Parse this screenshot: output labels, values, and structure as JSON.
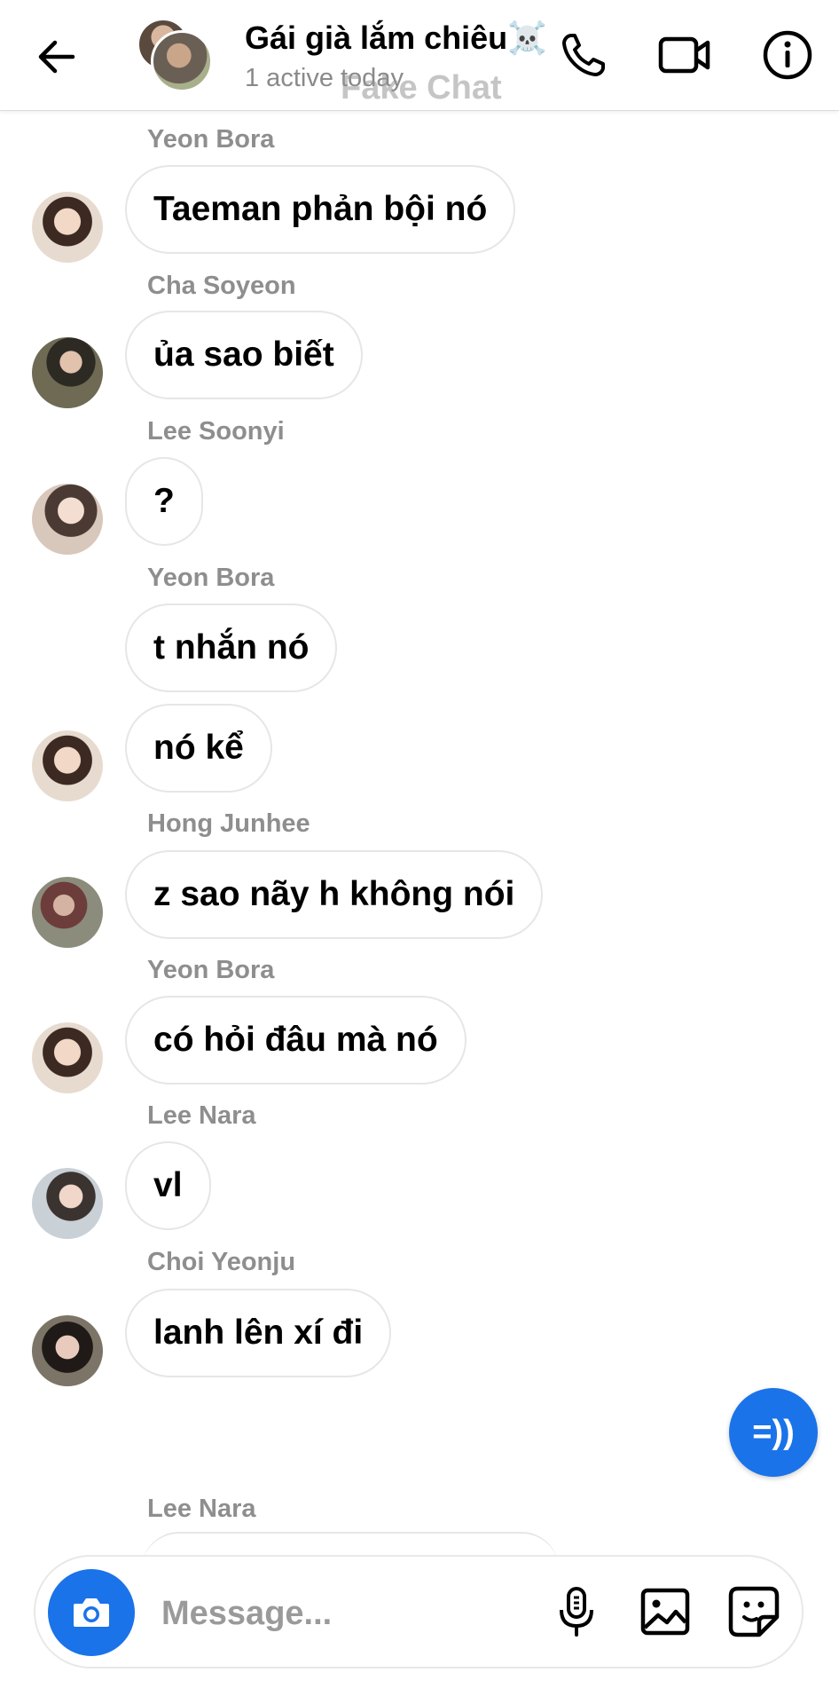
{
  "header": {
    "title": "Gái già lắm chiêu☠️",
    "status": "1 active today",
    "watermark": "Fake Chat"
  },
  "messages": [
    {
      "sender": "Yeon Bora",
      "text": "Taeman phản bội nó"
    },
    {
      "sender": "Cha Soyeon",
      "text": "ủa sao biết"
    },
    {
      "sender": "Lee Soonyi",
      "text": "?"
    },
    {
      "sender": "Yeon Bora",
      "text": "t nhắn nó"
    },
    {
      "sender": "",
      "text": "nó kể"
    },
    {
      "sender": "Hong Junhee",
      "text": "z sao nãy h không nói"
    },
    {
      "sender": "Yeon Bora",
      "text": "có hỏi đâu mà nó"
    },
    {
      "sender": "Lee Nara",
      "text": "vl"
    },
    {
      "sender": "Choi Yeonju",
      "text": "lanh lên xí đi"
    },
    {
      "sender": "Lee Nara",
      "text": ""
    }
  ],
  "voice_fab": {
    "label": "=))"
  },
  "composer": {
    "placeholder": "Message...",
    "value": ""
  },
  "icons": {
    "back": "arrow-left-icon",
    "call": "phone-icon",
    "video": "video-camera-icon",
    "info": "info-icon",
    "camera": "camera-icon",
    "mic": "microphone-icon",
    "gallery": "image-icon",
    "sticker": "sticker-icon"
  },
  "colors": {
    "accent": "#1a73e8",
    "sender_name": "#8e8e8e",
    "bubble_border": "#e6e6e6"
  }
}
